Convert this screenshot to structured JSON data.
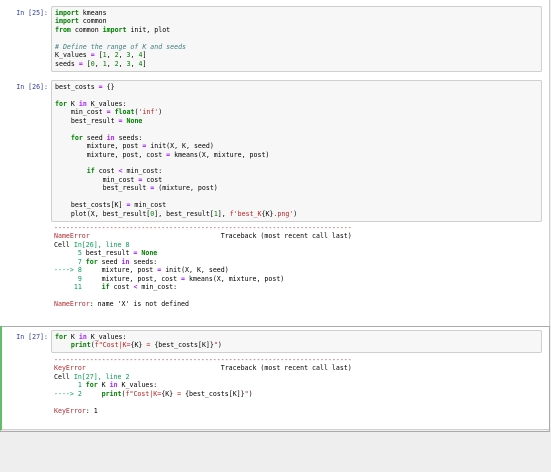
{
  "cells": [
    {
      "prompt": "In [25]:",
      "lines": [
        "import kmeans",
        "import common",
        "from common import init, plot",
        "",
        "# Define the range of K and seeds",
        "K_values = [1, 2, 3, 4]",
        "seeds = [0, 1, 2, 3, 4]"
      ]
    },
    {
      "prompt": "In [26]:",
      "lines": [
        "best_costs = {}",
        "",
        "for K in K_values:",
        "    min_cost = float('inf')",
        "    best_result = None",
        "",
        "    for seed in seeds:",
        "        mixture, post = init(X, K, seed)",
        "        mixture, post, cost = kmeans(X, mixture, post)",
        "",
        "        if cost < min_cost:",
        "            min_cost = cost",
        "            best_result = (mixture, post)",
        "",
        "    best_costs[K] = min_cost",
        "    plot(X, best_result[0], best_result[1], f'best_K{K}.png')"
      ],
      "output": [
        "---------------------------------------------------------------------------",
        "NameError                                 Traceback (most recent call last)",
        "Cell In[26], line 8",
        "      5 best_result = None",
        "      7 for seed in seeds:",
        "----> 8     mixture, post = init(X, K, seed)",
        "      9     mixture, post, cost = kmeans(X, mixture, post)",
        "     11     if cost < min_cost:",
        "",
        "NameError: name 'X' is not defined"
      ]
    },
    {
      "prompt": "In [27]:",
      "lines": [
        "for K in K_values:",
        "    print(f\"Cost|K={K} = {best_costs[K]}\")"
      ],
      "output": [
        "---------------------------------------------------------------------------",
        "KeyError                                  Traceback (most recent call last)",
        "Cell In[27], line 2",
        "      1 for K in K_values:",
        "----> 2     print(f\"Cost|K={K} = {best_costs[K]}\")",
        "",
        "KeyError: 1"
      ]
    }
  ],
  "colors": {
    "prompt": "#303f9f",
    "keyword": "#008000",
    "comment": "#408080",
    "string": "#ba2121",
    "error": "#b22b31",
    "selected_bar": "#66bb6a"
  }
}
